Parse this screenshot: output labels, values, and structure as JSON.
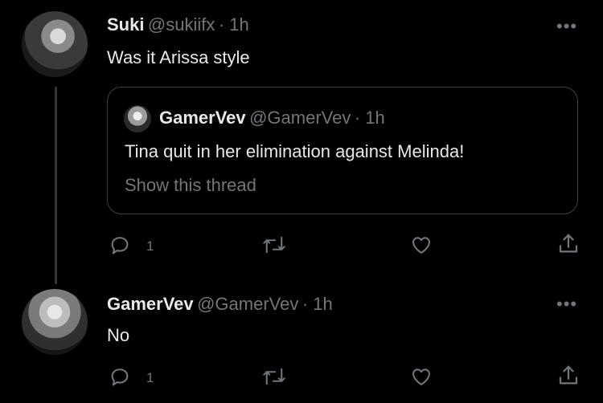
{
  "tweets": [
    {
      "name": "Suki",
      "handle": "@sukiifx",
      "time": "· 1h",
      "text": "Was it Arissa style",
      "reply_count": "1",
      "quote": {
        "name": "GamerVev",
        "handle": "@GamerVev",
        "time": "· 1h",
        "text": "Tina quit in her elimination against Melinda!",
        "link": "Show this thread"
      }
    },
    {
      "name": "GamerVev",
      "handle": "@GamerVev",
      "time": "· 1h",
      "text": "No",
      "reply_count": "1"
    }
  ],
  "more_label": "•••",
  "icons": {
    "reply": "reply-icon",
    "retweet": "retweet-icon",
    "like": "like-icon",
    "share": "share-icon",
    "more": "more-icon"
  },
  "colors": {
    "background": "#000000",
    "primary_text": "#e7e9ea",
    "secondary_text": "#71767b",
    "border": "#3e4144"
  }
}
